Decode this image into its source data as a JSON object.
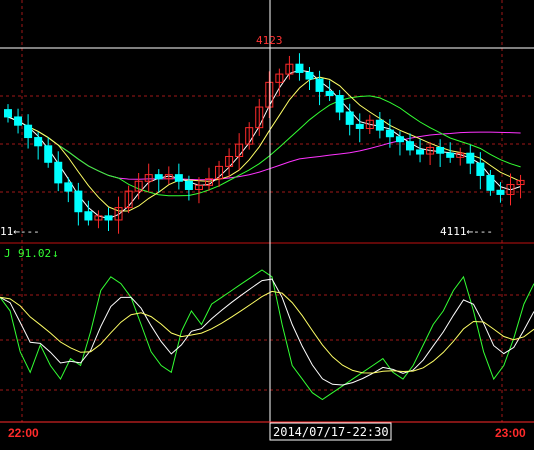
{
  "chart_data": [
    {
      "type": "candlestick",
      "panel": "price",
      "annotations": {
        "high_label": "4123",
        "low_label": "4111"
      },
      "series_lines": [
        {
          "color": "#ff33ff"
        },
        {
          "color": "#33ff33"
        },
        {
          "color": "#ffff66"
        },
        {
          "color": "#ffffff"
        }
      ],
      "colors": {
        "up": "#ff2a2a",
        "down": "#00ffff"
      }
    },
    {
      "type": "line",
      "panel": "indicator",
      "indicator_label": "J",
      "indicator_value": "91.02",
      "indicator_arrow": "↓",
      "series_colors": [
        "#33ff33",
        "#ffffff",
        "#ffff66"
      ]
    }
  ],
  "axis": {
    "time_start": "22:00",
    "time_end": "23:00",
    "cursor_time": "2014/07/17-22:30"
  },
  "colors": {
    "grid": "#a01818",
    "separator": "#c01010",
    "crosshair": "#ffffff",
    "indicator_text": "#33ff33"
  }
}
